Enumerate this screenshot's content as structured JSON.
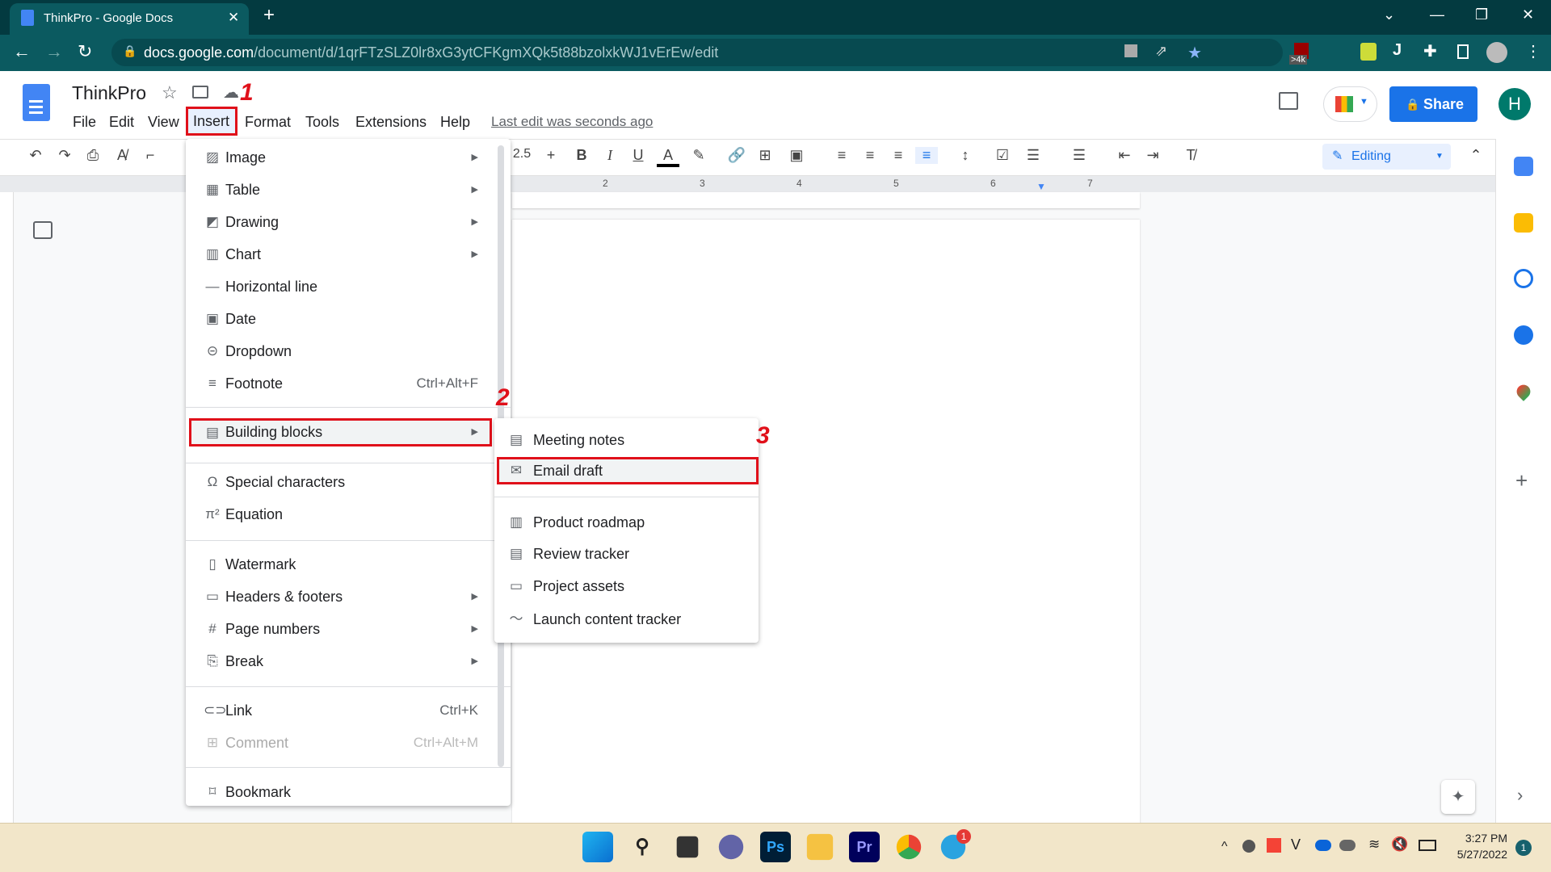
{
  "browser": {
    "tab_title": "ThinkPro - Google Docs",
    "url_host": "docs.google.com",
    "url_path": "/document/d/1qrFTzSLZ0lr8xG3ytCFKgmXQk5t88bzolxkWJ1vErEw/edit",
    "ext_badge": ">4k"
  },
  "doc": {
    "title": "ThinkPro",
    "last_edit": "Last edit was seconds ago",
    "share_label": "Share",
    "avatar_initial": "H",
    "editing_mode": "Editing",
    "font_size": "2.5"
  },
  "menubar": [
    "File",
    "Edit",
    "View",
    "Insert",
    "Format",
    "Tools",
    "Extensions",
    "Help"
  ],
  "insert_menu": [
    {
      "label": "Image",
      "icon": "image-icon",
      "submenu": true
    },
    {
      "label": "Table",
      "icon": "table-icon",
      "submenu": true
    },
    {
      "label": "Drawing",
      "icon": "drawing-icon",
      "submenu": true
    },
    {
      "label": "Chart",
      "icon": "chart-icon",
      "submenu": true
    },
    {
      "label": "Horizontal line",
      "icon": "horizontal-line-icon"
    },
    {
      "label": "Date",
      "icon": "calendar-icon"
    },
    {
      "label": "Dropdown",
      "icon": "dropdown-icon"
    },
    {
      "label": "Footnote",
      "icon": "footnote-icon",
      "shortcut": "Ctrl+Alt+F"
    },
    {
      "label": "Building blocks",
      "icon": "building-blocks-icon",
      "submenu": true
    },
    {
      "label": "Special characters",
      "icon": "omega-icon"
    },
    {
      "label": "Equation",
      "icon": "pi-icon"
    },
    {
      "label": "Watermark",
      "icon": "watermark-icon"
    },
    {
      "label": "Headers & footers",
      "icon": "header-footer-icon",
      "submenu": true
    },
    {
      "label": "Page numbers",
      "icon": "hash-icon",
      "submenu": true
    },
    {
      "label": "Break",
      "icon": "break-icon",
      "submenu": true
    },
    {
      "label": "Link",
      "icon": "link-icon",
      "shortcut": "Ctrl+K"
    },
    {
      "label": "Comment",
      "icon": "comment-icon",
      "shortcut": "Ctrl+Alt+M",
      "disabled": true
    },
    {
      "label": "Bookmark",
      "icon": "bookmark-icon"
    }
  ],
  "building_blocks_menu": [
    {
      "label": "Meeting notes",
      "icon": "document-icon"
    },
    {
      "label": "Email draft",
      "icon": "email-icon"
    },
    {
      "label": "Product roadmap",
      "icon": "map-icon"
    },
    {
      "label": "Review tracker",
      "icon": "clipboard-icon"
    },
    {
      "label": "Project assets",
      "icon": "archive-icon"
    },
    {
      "label": "Launch content tracker",
      "icon": "trend-icon"
    }
  ],
  "annotations": [
    "1",
    "2",
    "3"
  ],
  "ruler_numbers": [
    "2",
    "3",
    "4",
    "5",
    "6",
    "7"
  ],
  "taskbar": {
    "time": "3:27 PM",
    "date": "5/27/2022",
    "notification_count": "1",
    "telegram_badge": "1",
    "apps": [
      "Ps",
      "Pr"
    ]
  },
  "colors": {
    "accent": "#1a73e8",
    "highlight": "#e0101a",
    "chrome": "#0b5a60"
  }
}
